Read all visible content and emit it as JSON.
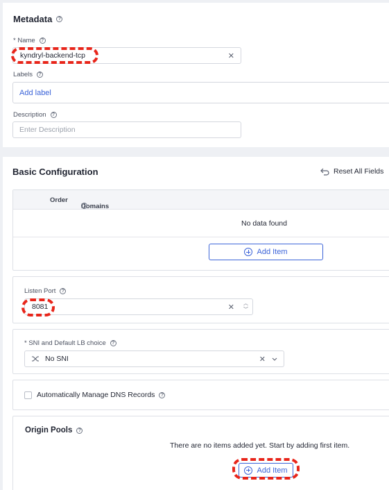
{
  "metadata": {
    "title": "Metadata",
    "name_label": "* Name",
    "name_value": "kyndryl-backend-tcp",
    "labels_label": "Labels",
    "add_label": "Add label",
    "description_label": "Description",
    "description_placeholder": "Enter Description"
  },
  "basic": {
    "title": "Basic Configuration",
    "reset_label": "Reset All Fields",
    "table": {
      "columns": [
        "Order",
        "Domains"
      ],
      "empty_text": "No data found",
      "add_item": "Add Item"
    },
    "listen_port": {
      "label": "Listen Port",
      "value": "8081"
    },
    "sni": {
      "label": "* SNI and Default LB choice",
      "value": "No SNI"
    },
    "dns_checkbox_label": "Automatically Manage DNS Records",
    "origin_pools": {
      "title": "Origin Pools",
      "empty_text": "There are no items added yet. Start by adding first item.",
      "add_item": "Add Item"
    }
  },
  "icons": {
    "clear": "x-icon",
    "help": "question-circle-icon",
    "reset": "undo-arrow-icon",
    "add": "plus-circle-icon",
    "sni": "shuffle-icon",
    "chevron": "chevron-down-icon"
  },
  "colors": {
    "accent": "#3b63d8",
    "annotation": "#e8251a"
  }
}
